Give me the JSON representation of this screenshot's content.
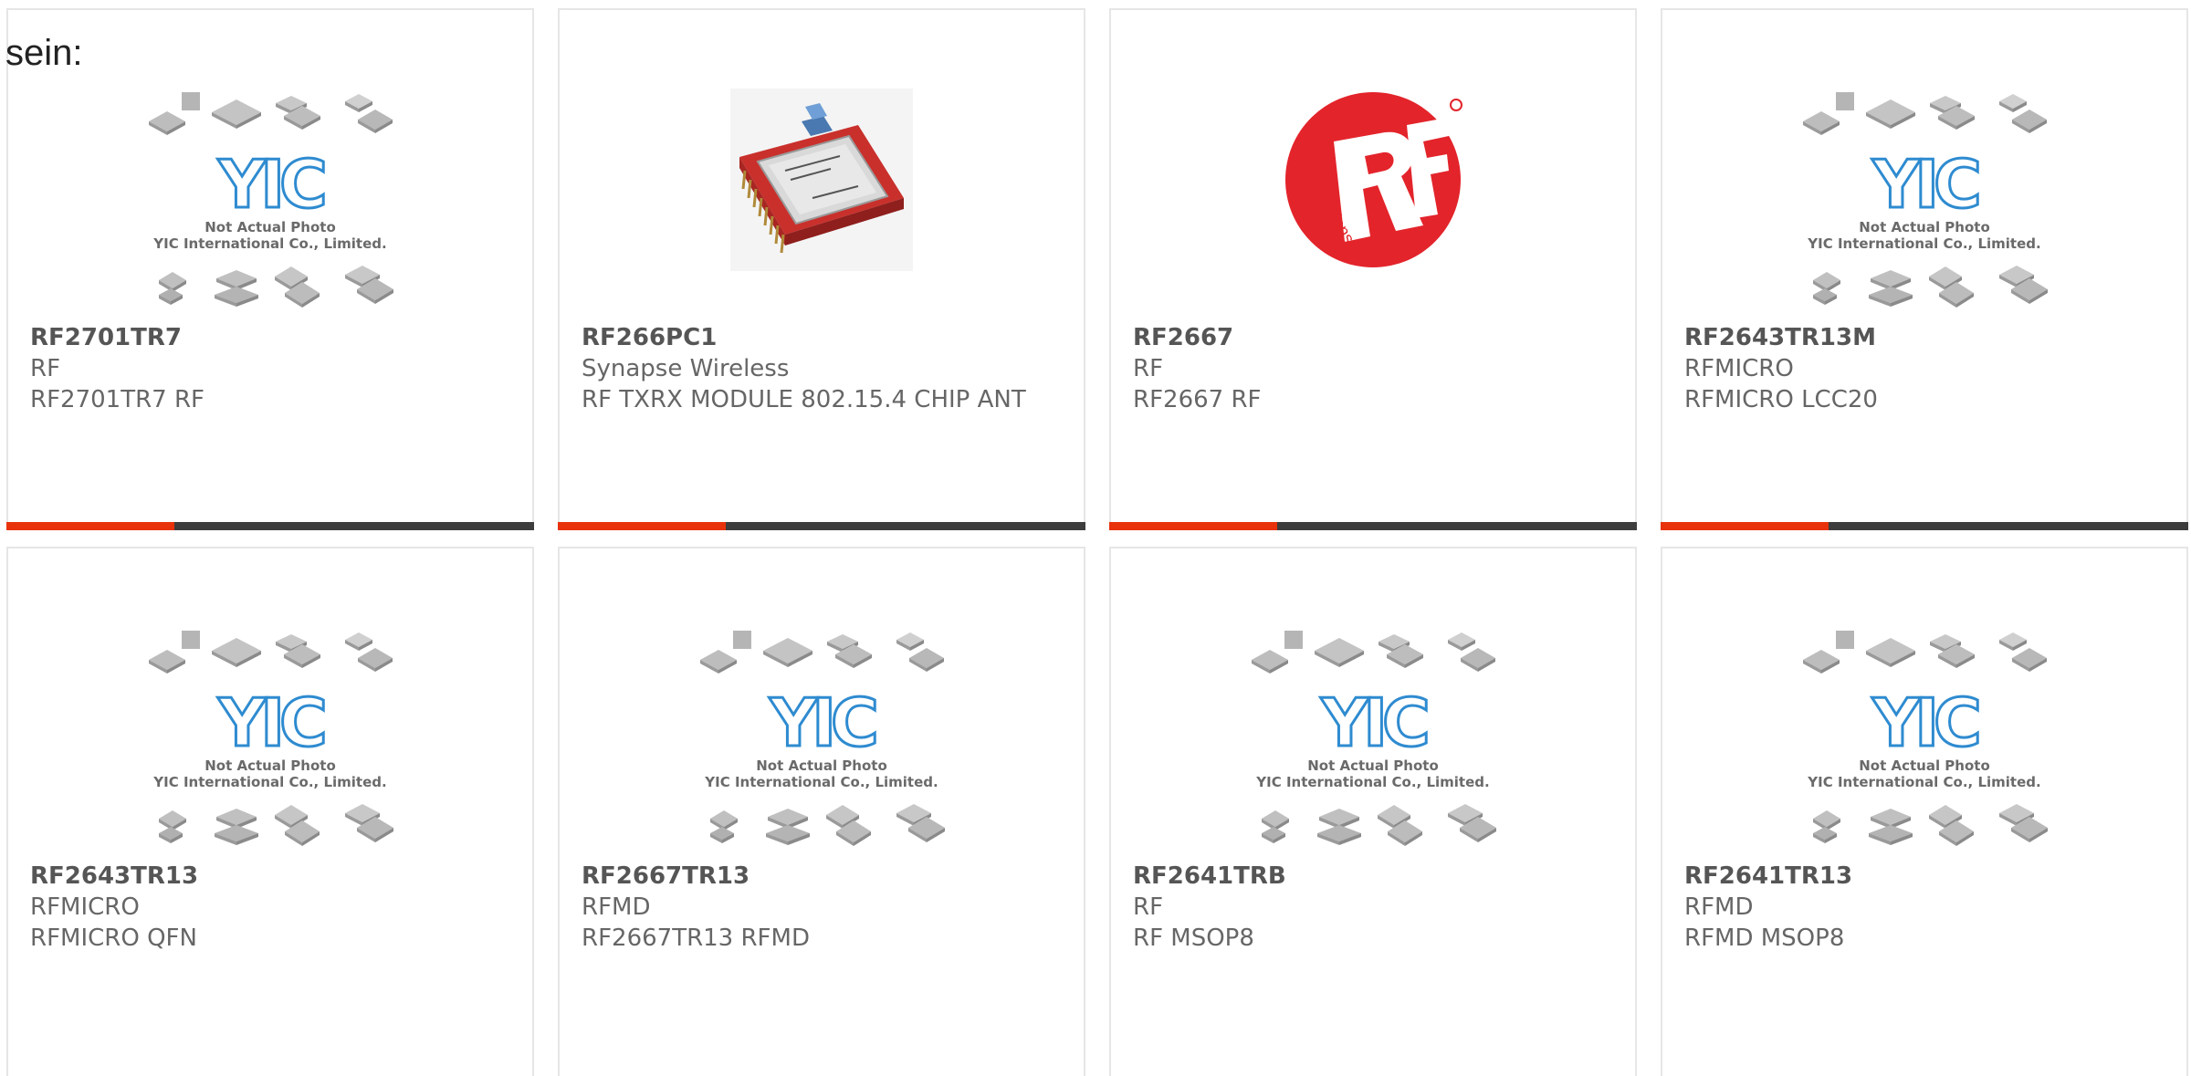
{
  "intro_text": "sein:",
  "colors": {
    "accent": "#e8320b",
    "bar": "#3d3d3d",
    "border": "#e6e6e6",
    "text": "#666666",
    "yic_blue": "#2e8bd0",
    "rf_red": "#e3242b"
  },
  "placeholder_image": {
    "brand": "YIC",
    "caption_line1": "Not Actual Photo",
    "caption_line2": "YIC International Co., Limited."
  },
  "products": [
    {
      "part": "RF2701TR7",
      "maker": "RF",
      "desc": "RF2701TR7 RF",
      "image": "yic-placeholder-icon"
    },
    {
      "part": "RF266PC1",
      "maker": "Synapse Wireless",
      "desc": "RF TXRX MODULE 802.15.4 CHIP ANT",
      "image": "rf-module-photo-icon"
    },
    {
      "part": "RF2667",
      "maker": "RF",
      "desc": "RF2667 RF",
      "image": "rf-solutions-logo-icon",
      "logo_text": "rfsolutions"
    },
    {
      "part": "RF2643TR13M",
      "maker": "RFMICRO",
      "desc": "RFMICRO LCC20",
      "image": "yic-placeholder-icon"
    },
    {
      "part": "RF2643TR13",
      "maker": "RFMICRO",
      "desc": "RFMICRO QFN",
      "image": "yic-placeholder-icon"
    },
    {
      "part": "RF2667TR13",
      "maker": "RFMD",
      "desc": "RF2667TR13 RFMD",
      "image": "yic-placeholder-icon"
    },
    {
      "part": "RF2641TRB",
      "maker": "RF",
      "desc": "RF MSOP8",
      "image": "yic-placeholder-icon"
    },
    {
      "part": "RF2641TR13",
      "maker": "RFMD",
      "desc": "RFMD MSOP8",
      "image": "yic-placeholder-icon"
    }
  ]
}
